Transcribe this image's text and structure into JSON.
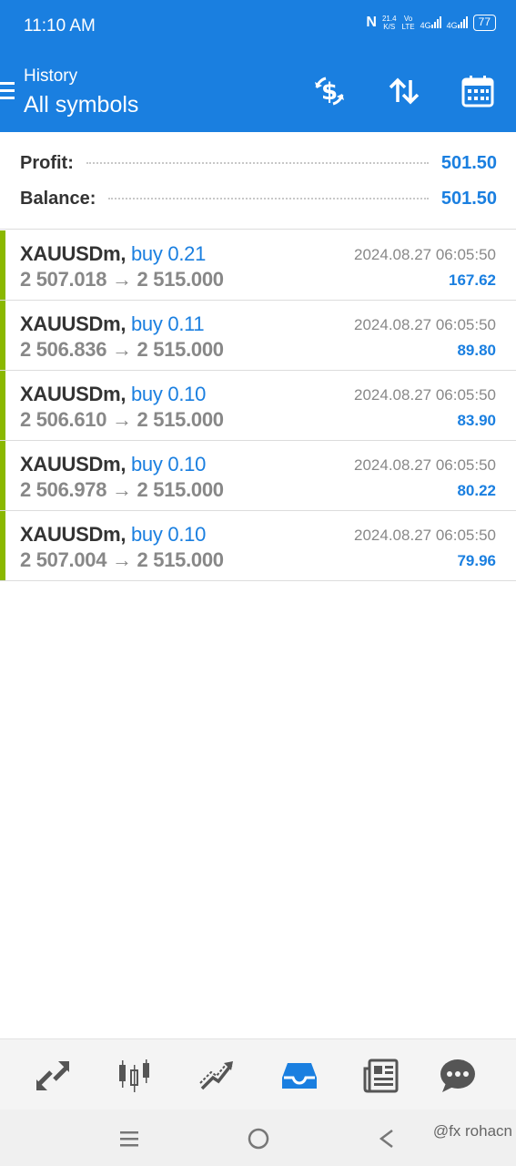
{
  "status_bar": {
    "time": "11:10 AM",
    "net_speed": "21.4",
    "net_speed_unit": "K/S",
    "volte_top": "Vo",
    "volte_bottom": "LTE",
    "net1": "4G",
    "net2": "4G",
    "battery": "77"
  },
  "app_bar": {
    "subtitle": "History",
    "title": "All symbols",
    "icons": [
      "menu-icon",
      "currency-exchange-icon",
      "sort-icon",
      "calendar-icon"
    ]
  },
  "summary": {
    "profit_label": "Profit:",
    "profit_value": "501.50",
    "balance_label": "Balance:",
    "balance_value": "501.50"
  },
  "trades": [
    {
      "symbol": "XAUUSDm,",
      "side": "buy 0.21",
      "open_price": "2 507.018",
      "arrow": "→",
      "close_price": "2 515.000",
      "time": "2024.08.27 06:05:50",
      "profit": "167.62"
    },
    {
      "symbol": "XAUUSDm,",
      "side": "buy 0.11",
      "open_price": "2 506.836",
      "arrow": "→",
      "close_price": "2 515.000",
      "time": "2024.08.27 06:05:50",
      "profit": "89.80"
    },
    {
      "symbol": "XAUUSDm,",
      "side": "buy 0.10",
      "open_price": "2 506.610",
      "arrow": "→",
      "close_price": "2 515.000",
      "time": "2024.08.27 06:05:50",
      "profit": "83.90"
    },
    {
      "symbol": "XAUUSDm,",
      "side": "buy 0.10",
      "open_price": "2 506.978",
      "arrow": "→",
      "close_price": "2 515.000",
      "time": "2024.08.27 06:05:50",
      "profit": "80.22"
    },
    {
      "symbol": "XAUUSDm,",
      "side": "buy 0.10",
      "open_price": "2 507.004",
      "arrow": "→",
      "close_price": "2 515.000",
      "time": "2024.08.27 06:05:50",
      "profit": "79.96"
    }
  ],
  "bottom_nav": {
    "items": [
      "quotes-icon",
      "chart-icon",
      "trade-icon",
      "history-icon",
      "news-icon",
      "chat-icon"
    ],
    "active": "history-icon"
  },
  "system_nav": {
    "watermark": "@fx rohacn"
  },
  "colors": {
    "accent": "#1a7fe0",
    "buy_bar": "#8ab800",
    "text_dark": "#333333",
    "text_gray": "#888888"
  }
}
